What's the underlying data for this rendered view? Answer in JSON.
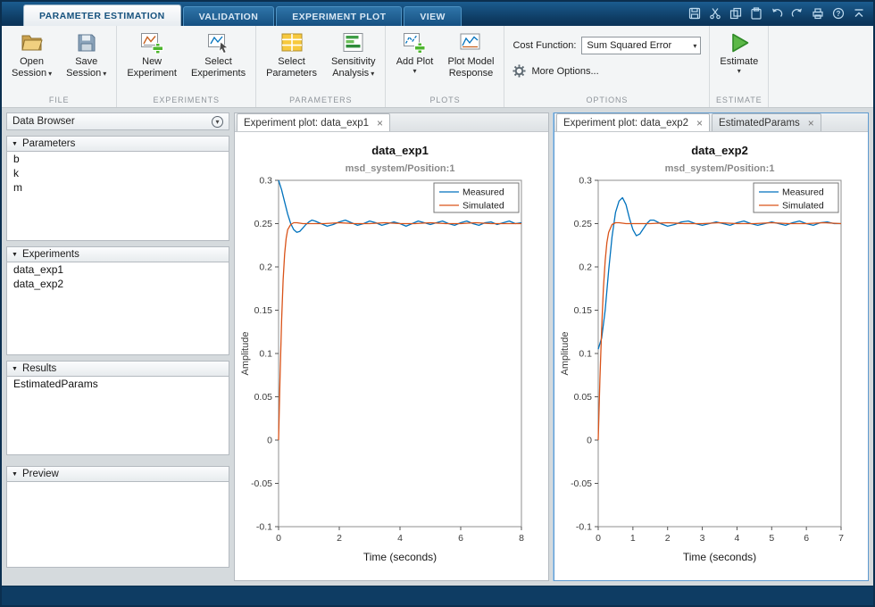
{
  "icons": {
    "dropdown_arrow": "▾",
    "close": "×",
    "section_collapse": "▼"
  },
  "titlebar": {
    "tabs": [
      {
        "label": "PARAMETER ESTIMATION",
        "active": true
      },
      {
        "label": "VALIDATION",
        "active": false
      },
      {
        "label": "EXPERIMENT PLOT",
        "active": false
      },
      {
        "label": "VIEW",
        "active": false
      }
    ],
    "quick_icons": [
      "save",
      "cut",
      "copy",
      "paste",
      "undo",
      "redo",
      "print",
      "help"
    ]
  },
  "ribbon": {
    "groups": [
      {
        "label": "FILE",
        "buttons": [
          {
            "name": "open-session",
            "lines": [
              "Open",
              "Session"
            ],
            "dropdown": true,
            "icon": "folder-open-icon"
          },
          {
            "name": "save-session",
            "lines": [
              "Save",
              "Session"
            ],
            "dropdown": true,
            "icon": "save-icon"
          }
        ]
      },
      {
        "label": "EXPERIMENTS",
        "buttons": [
          {
            "name": "new-experiment",
            "lines": [
              "New",
              "Experiment"
            ],
            "dropdown": false,
            "icon": "new-experiment-icon"
          },
          {
            "name": "select-experiments",
            "lines": [
              "Select",
              "Experiments"
            ],
            "dropdown": false,
            "icon": "select-experiments-icon"
          }
        ]
      },
      {
        "label": "PARAMETERS",
        "buttons": [
          {
            "name": "select-parameters",
            "lines": [
              "Select",
              "Parameters"
            ],
            "dropdown": false,
            "icon": "select-parameters-icon"
          },
          {
            "name": "sensitivity-analysis",
            "lines": [
              "Sensitivity",
              "Analysis"
            ],
            "dropdown": true,
            "icon": "sensitivity-analysis-icon"
          }
        ]
      },
      {
        "label": "PLOTS",
        "buttons": [
          {
            "name": "add-plot",
            "lines": [
              "Add Plot"
            ],
            "dropdown": true,
            "icon": "add-plot-icon"
          },
          {
            "name": "plot-model-response",
            "lines": [
              "Plot Model",
              "Response"
            ],
            "dropdown": false,
            "icon": "plot-model-response-icon"
          }
        ]
      },
      {
        "label": "OPTIONS",
        "cost_function": {
          "label": "Cost Function:",
          "value": "Sum Squared Error"
        },
        "more_options": "More Options..."
      },
      {
        "label": "ESTIMATE",
        "buttons": [
          {
            "name": "estimate",
            "lines": [
              "Estimate"
            ],
            "dropdown": true,
            "icon": "run-icon"
          }
        ]
      }
    ]
  },
  "data_browser": {
    "title": "Data Browser",
    "sections": [
      {
        "label": "Parameters",
        "items": [
          "b",
          "k",
          "m"
        ]
      },
      {
        "label": "Experiments",
        "items": [
          "data_exp1",
          "data_exp2"
        ]
      },
      {
        "label": "Results",
        "items": [
          "EstimatedParams"
        ]
      },
      {
        "label": "Preview",
        "items": []
      }
    ]
  },
  "documents": [
    {
      "active_panel": false,
      "chart_index": 0,
      "tabs": [
        {
          "label": "Experiment plot: data_exp1",
          "active": true
        }
      ]
    },
    {
      "active_panel": true,
      "chart_index": 1,
      "tabs": [
        {
          "label": "Experiment plot: data_exp2",
          "active": true
        },
        {
          "label": "EstimatedParams",
          "active": false
        }
      ]
    }
  ],
  "chart_data": [
    {
      "type": "line",
      "title": "data_exp1",
      "subtitle": "msd_system/Position:1",
      "xlabel": "Time (seconds)",
      "ylabel": "Amplitude",
      "xlim": [
        0,
        8
      ],
      "ylim": [
        -0.1,
        0.3
      ],
      "xticks": [
        0,
        2,
        4,
        6,
        8
      ],
      "yticks": [
        -0.1,
        -0.05,
        0,
        0.05,
        0.1,
        0.15,
        0.2,
        0.25,
        0.3
      ],
      "legend_position": "top-right",
      "grid": false,
      "series": [
        {
          "name": "Measured",
          "color": "#0072bd",
          "points": [
            [
              0,
              0.3
            ],
            [
              0.1,
              0.289
            ],
            [
              0.2,
              0.275
            ],
            [
              0.3,
              0.261
            ],
            [
              0.4,
              0.25
            ],
            [
              0.5,
              0.243
            ],
            [
              0.6,
              0.24
            ],
            [
              0.7,
              0.241
            ],
            [
              0.8,
              0.245
            ],
            [
              0.9,
              0.249
            ],
            [
              1,
              0.252
            ],
            [
              1.1,
              0.254
            ],
            [
              1.2,
              0.253
            ],
            [
              1.4,
              0.25
            ],
            [
              1.6,
              0.247
            ],
            [
              1.8,
              0.249
            ],
            [
              2,
              0.252
            ],
            [
              2.2,
              0.254
            ],
            [
              2.4,
              0.251
            ],
            [
              2.6,
              0.248
            ],
            [
              2.8,
              0.25
            ],
            [
              3,
              0.253
            ],
            [
              3.2,
              0.251
            ],
            [
              3.4,
              0.248
            ],
            [
              3.6,
              0.25
            ],
            [
              3.8,
              0.252
            ],
            [
              4,
              0.25
            ],
            [
              4.2,
              0.247
            ],
            [
              4.4,
              0.25
            ],
            [
              4.6,
              0.253
            ],
            [
              4.8,
              0.251
            ],
            [
              5,
              0.249
            ],
            [
              5.2,
              0.251
            ],
            [
              5.4,
              0.253
            ],
            [
              5.6,
              0.25
            ],
            [
              5.8,
              0.248
            ],
            [
              6,
              0.251
            ],
            [
              6.2,
              0.253
            ],
            [
              6.4,
              0.25
            ],
            [
              6.6,
              0.248
            ],
            [
              6.8,
              0.251
            ],
            [
              7,
              0.252
            ],
            [
              7.2,
              0.249
            ],
            [
              7.4,
              0.251
            ],
            [
              7.6,
              0.253
            ],
            [
              7.8,
              0.25
            ],
            [
              8,
              0.251
            ]
          ]
        },
        {
          "name": "Simulated",
          "color": "#d95319",
          "points": [
            [
              0,
              0
            ],
            [
              0.05,
              0.075
            ],
            [
              0.1,
              0.138
            ],
            [
              0.15,
              0.185
            ],
            [
              0.2,
              0.215
            ],
            [
              0.25,
              0.233
            ],
            [
              0.3,
              0.243
            ],
            [
              0.4,
              0.249
            ],
            [
              0.5,
              0.251
            ],
            [
              0.6,
              0.251
            ],
            [
              0.8,
              0.25
            ],
            [
              1,
              0.25
            ],
            [
              1.5,
              0.25
            ],
            [
              2,
              0.251
            ],
            [
              2.5,
              0.25
            ],
            [
              3,
              0.25
            ],
            [
              3.5,
              0.251
            ],
            [
              4,
              0.25
            ],
            [
              4.5,
              0.25
            ],
            [
              5,
              0.251
            ],
            [
              5.5,
              0.25
            ],
            [
              6,
              0.25
            ],
            [
              6.5,
              0.251
            ],
            [
              7,
              0.25
            ],
            [
              7.5,
              0.25
            ],
            [
              8,
              0.25
            ]
          ]
        }
      ]
    },
    {
      "type": "line",
      "title": "data_exp2",
      "subtitle": "msd_system/Position:1",
      "xlabel": "Time (seconds)",
      "ylabel": "Amplitude",
      "xlim": [
        0,
        7
      ],
      "ylim": [
        -0.1,
        0.3
      ],
      "xticks": [
        0,
        1,
        2,
        3,
        4,
        5,
        6,
        7
      ],
      "yticks": [
        -0.1,
        -0.05,
        0,
        0.05,
        0.1,
        0.15,
        0.2,
        0.25,
        0.3
      ],
      "legend_position": "top-right",
      "grid": false,
      "series": [
        {
          "name": "Measured",
          "color": "#0072bd",
          "points": [
            [
              0,
              0.105
            ],
            [
              0.1,
              0.118
            ],
            [
              0.2,
              0.15
            ],
            [
              0.3,
              0.196
            ],
            [
              0.4,
              0.235
            ],
            [
              0.5,
              0.263
            ],
            [
              0.6,
              0.276
            ],
            [
              0.7,
              0.28
            ],
            [
              0.8,
              0.272
            ],
            [
              0.9,
              0.256
            ],
            [
              1,
              0.243
            ],
            [
              1.1,
              0.236
            ],
            [
              1.2,
              0.238
            ],
            [
              1.3,
              0.244
            ],
            [
              1.4,
              0.25
            ],
            [
              1.5,
              0.254
            ],
            [
              1.6,
              0.254
            ],
            [
              1.8,
              0.25
            ],
            [
              2,
              0.247
            ],
            [
              2.2,
              0.249
            ],
            [
              2.4,
              0.252
            ],
            [
              2.6,
              0.253
            ],
            [
              2.8,
              0.25
            ],
            [
              3,
              0.248
            ],
            [
              3.2,
              0.25
            ],
            [
              3.4,
              0.252
            ],
            [
              3.6,
              0.25
            ],
            [
              3.8,
              0.248
            ],
            [
              4,
              0.251
            ],
            [
              4.2,
              0.253
            ],
            [
              4.4,
              0.25
            ],
            [
              4.6,
              0.248
            ],
            [
              4.8,
              0.25
            ],
            [
              5,
              0.252
            ],
            [
              5.2,
              0.25
            ],
            [
              5.4,
              0.248
            ],
            [
              5.6,
              0.251
            ],
            [
              5.8,
              0.253
            ],
            [
              6,
              0.25
            ],
            [
              6.2,
              0.248
            ],
            [
              6.4,
              0.251
            ],
            [
              6.6,
              0.252
            ],
            [
              6.8,
              0.25
            ],
            [
              7,
              0.25
            ]
          ]
        },
        {
          "name": "Simulated",
          "color": "#d95319",
          "points": [
            [
              0,
              0
            ],
            [
              0.05,
              0.07
            ],
            [
              0.1,
              0.13
            ],
            [
              0.15,
              0.175
            ],
            [
              0.2,
              0.207
            ],
            [
              0.25,
              0.228
            ],
            [
              0.3,
              0.24
            ],
            [
              0.4,
              0.249
            ],
            [
              0.5,
              0.251
            ],
            [
              0.6,
              0.251
            ],
            [
              0.8,
              0.25
            ],
            [
              1,
              0.25
            ],
            [
              1.5,
              0.25
            ],
            [
              2,
              0.251
            ],
            [
              2.5,
              0.25
            ],
            [
              3,
              0.25
            ],
            [
              3.5,
              0.251
            ],
            [
              4,
              0.25
            ],
            [
              4.5,
              0.25
            ],
            [
              5,
              0.251
            ],
            [
              5.5,
              0.25
            ],
            [
              6,
              0.25
            ],
            [
              6.5,
              0.251
            ],
            [
              7,
              0.25
            ]
          ]
        }
      ]
    }
  ]
}
